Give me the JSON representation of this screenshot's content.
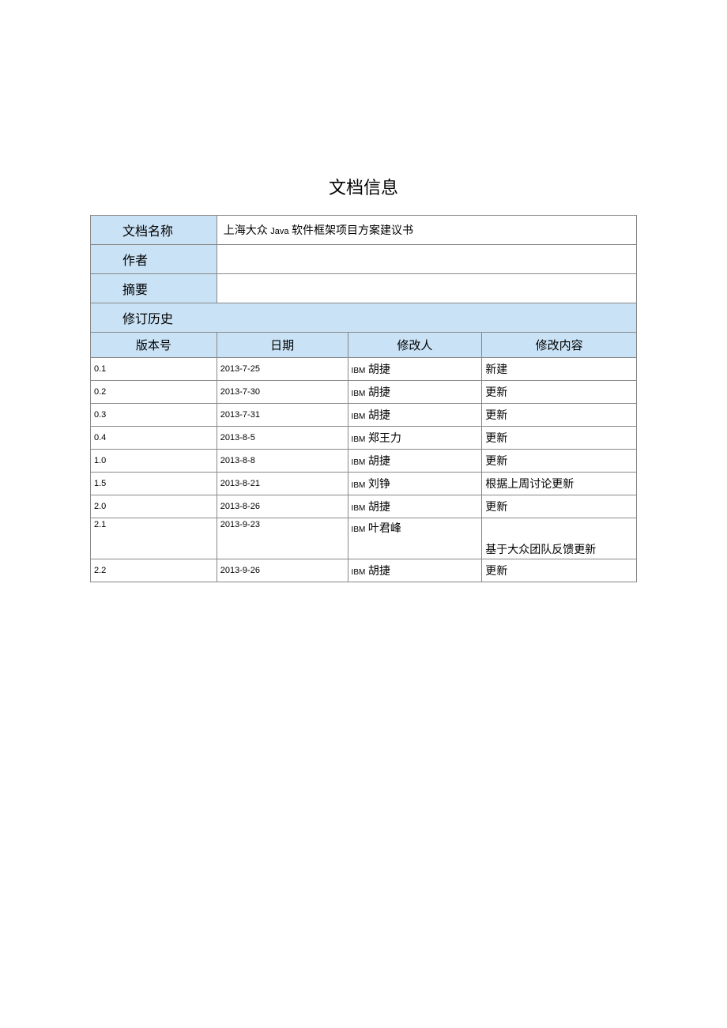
{
  "page_title": "文档信息",
  "info": {
    "doc_name_label": "文档名称",
    "doc_name_prefix": "上海大众 ",
    "doc_name_java": "Java",
    "doc_name_suffix": " 软件框架项目方案建议书",
    "author_label": "作者",
    "author_value": "",
    "summary_label": "摘要",
    "summary_value": "",
    "history_label": "修订历史"
  },
  "columns": {
    "version": "版本号",
    "date": "日期",
    "modifier": "修改人",
    "content": "修改内容"
  },
  "ibm_prefix": "IBM",
  "rows": [
    {
      "version": "0.1",
      "date": "2013-7-25",
      "modifier": " 胡捷",
      "content": "新建"
    },
    {
      "version": "0.2",
      "date": "2013-7-30",
      "modifier": " 胡捷",
      "content": "更新"
    },
    {
      "version": "0.3",
      "date": "2013-7-31",
      "modifier": " 胡捷",
      "content": "更新"
    },
    {
      "version": "0.4",
      "date": "2013-8-5",
      "modifier": " 郑王力",
      "content": "更新"
    },
    {
      "version": "1.0",
      "date": "2013-8-8",
      "modifier": " 胡捷",
      "content": "更新"
    },
    {
      "version": "1.5",
      "date": "2013-8-21",
      "modifier": " 刘铮",
      "content": "根据上周讨论更新"
    },
    {
      "version": "2.0",
      "date": "2013-8-26",
      "modifier": " 胡捷",
      "content": "更新"
    },
    {
      "version": "2.1",
      "date": "2013-9-23",
      "modifier": " 叶君峰",
      "content": "基于大众团队反馈更新"
    },
    {
      "version": "2.2",
      "date": "2013-9-26",
      "modifier": " 胡捷",
      "content": "更新"
    }
  ]
}
